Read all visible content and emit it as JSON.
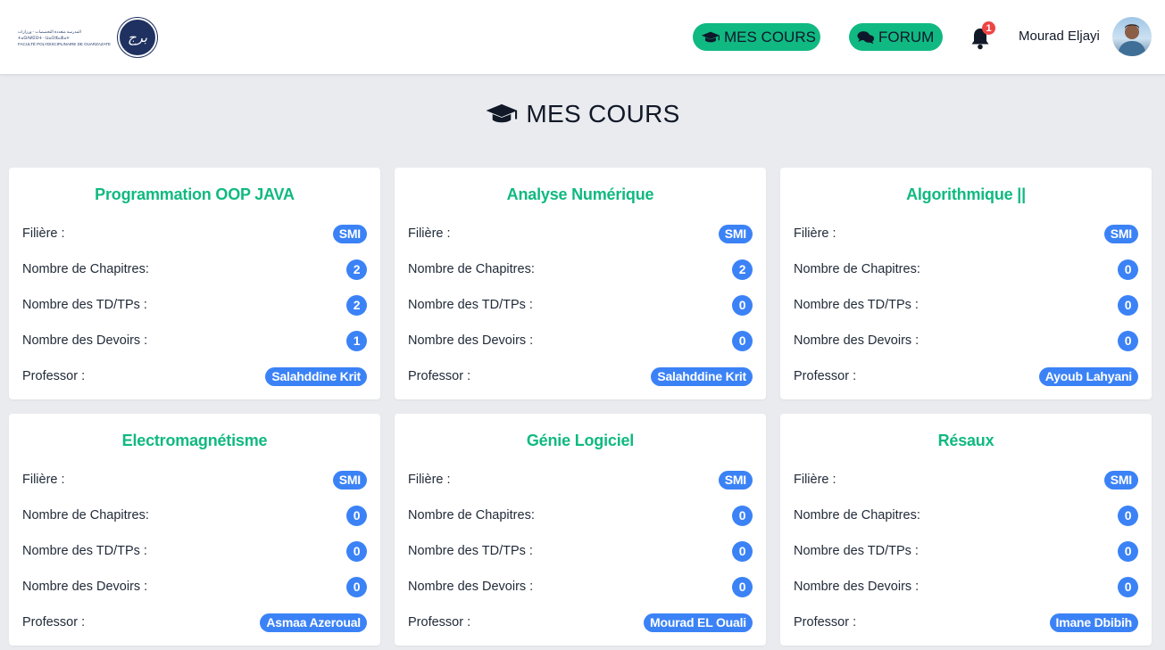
{
  "logo": {
    "line1": "المدرسة متعددة التخصصات - ورزازات",
    "line2": "ⵜⴰⵙⴷⵍⵉⵙⵜ - ⵡⴰⵔⵣⴰⵣⴰⵜ",
    "line3": "FACULTÉ POLYDISCIPLINAIRE DE OUARZAZATE",
    "seal_text": "ﺑﺮﺝ"
  },
  "nav": {
    "mes_cours": "MES COURS",
    "forum": "FORUM",
    "notifications_count": "1",
    "user_name": "Mourad Eljayi"
  },
  "page_title": "MES COURS",
  "labels": {
    "filiere": "Filière :",
    "chapitres": "Nombre de Chapitres:",
    "tdtps": "Nombre des TD/TPs :",
    "devoirs": "Nombre des Devoirs :",
    "professor": "Professor :"
  },
  "courses": [
    {
      "title": "Programmation OOP JAVA",
      "filiere": "SMI",
      "chapitres": "2",
      "tdtps": "2",
      "devoirs": "1",
      "professor": "Salahddine Krit"
    },
    {
      "title": "Analyse Numérique",
      "filiere": "SMI",
      "chapitres": "2",
      "tdtps": "0",
      "devoirs": "0",
      "professor": "Salahddine Krit"
    },
    {
      "title": "Algorithmique ||",
      "filiere": "SMI",
      "chapitres": "0",
      "tdtps": "0",
      "devoirs": "0",
      "professor": "Ayoub Lahyani"
    },
    {
      "title": "Electromagnétisme",
      "filiere": "SMI",
      "chapitres": "0",
      "tdtps": "0",
      "devoirs": "0",
      "professor": "Asmaa Azeroual"
    },
    {
      "title": "Génie Logiciel",
      "filiere": "SMI",
      "chapitres": "0",
      "tdtps": "0",
      "devoirs": "0",
      "professor": "Mourad EL Ouali"
    },
    {
      "title": "Résaux",
      "filiere": "SMI",
      "chapitres": "0",
      "tdtps": "0",
      "devoirs": "0",
      "professor": "Imane Dbibih"
    }
  ],
  "colors": {
    "accent_green": "#10b981",
    "badge_blue": "#3b82f6",
    "notification_red": "#ef4444"
  }
}
